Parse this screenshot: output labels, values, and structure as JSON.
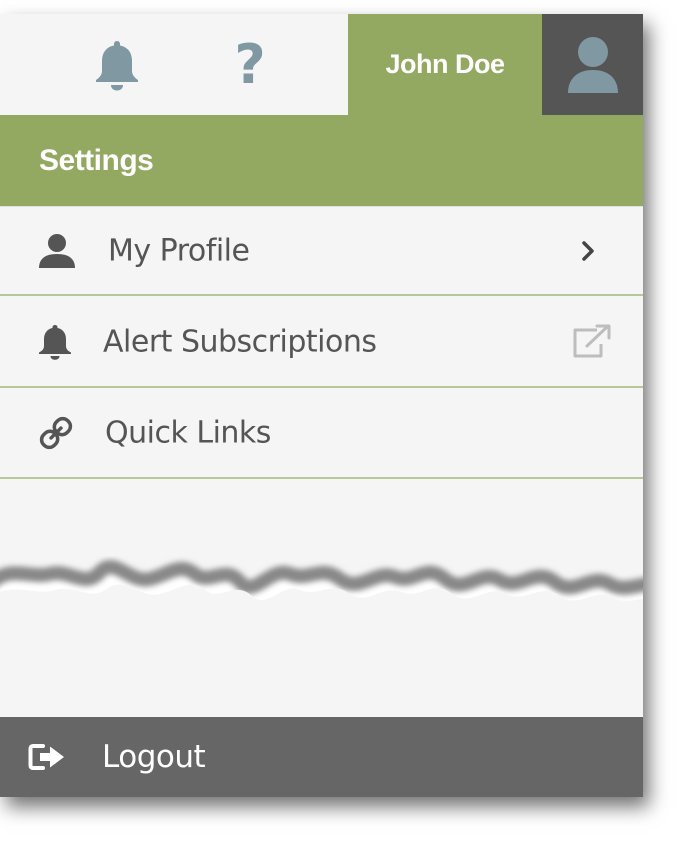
{
  "topbar": {
    "notifications_icon": "bell-icon",
    "help_icon": "question-icon",
    "help_glyph": "?",
    "user_name": "John Doe",
    "avatar_icon": "user-avatar-icon"
  },
  "settings": {
    "title": "Settings"
  },
  "menu": {
    "items": [
      {
        "label": "My Profile",
        "icon": "user-icon",
        "trailing": "chevron-right-icon"
      },
      {
        "label": "Alert Subscriptions",
        "icon": "bell-icon",
        "trailing": "external-link-icon"
      },
      {
        "label": "Quick Links",
        "icon": "link-icon",
        "trailing": ""
      }
    ]
  },
  "footer": {
    "logout_label": "Logout",
    "logout_icon": "sign-out-icon"
  },
  "colors": {
    "accent_green": "#93a860",
    "panel_bg": "#f5f5f5",
    "dark_gray": "#555555",
    "logout_bg": "#666666",
    "icon_blue_gray": "#7f98a2"
  }
}
